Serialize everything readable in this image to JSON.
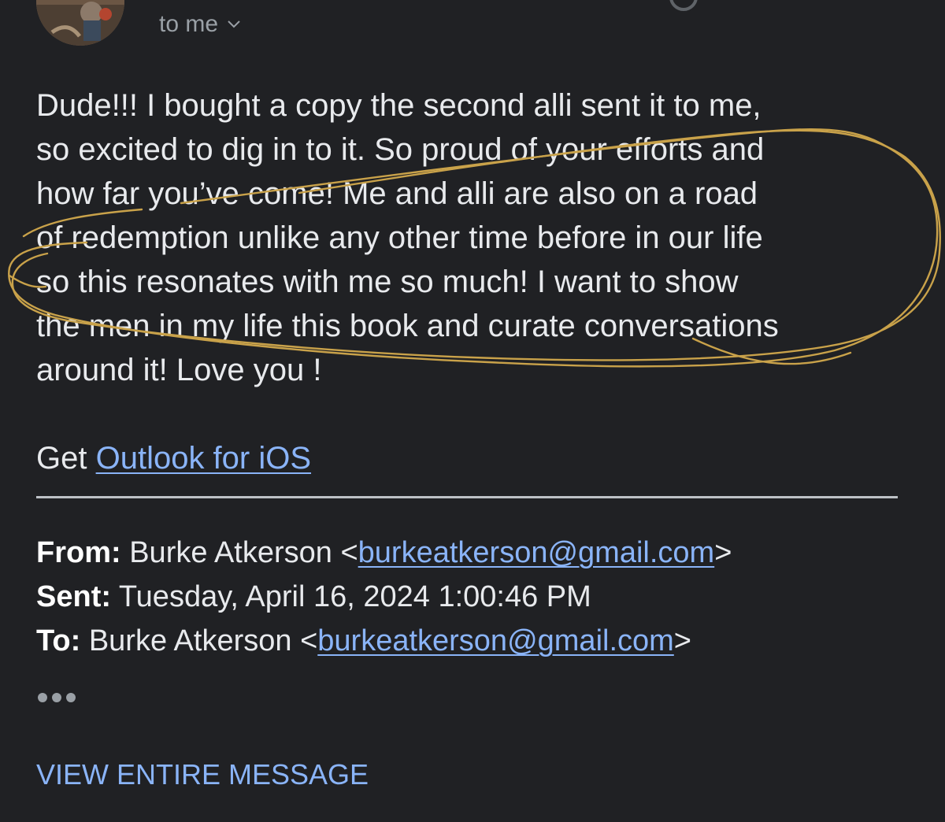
{
  "header": {
    "recipient_label": "to me"
  },
  "message": {
    "body_lines": [
      "Dude!!! I bought a copy the second alli sent it to me,",
      "so excited to dig in to it. So proud of your efforts and",
      "how far you’ve come! Me and alli are also on a road",
      "of redemption unlike any other time before in our life",
      "so this resonates with me so much! I want to show",
      "the men in my life this book and curate conversations",
      "around it! Love you !"
    ],
    "signature_prefix": "Get ",
    "signature_link": "Outlook for iOS"
  },
  "quoted_header": {
    "from_label": "From:",
    "from_name": " Burke Atkerson <",
    "from_email": "burkeatkerson@gmail.com",
    "from_suffix": ">",
    "sent_label": "Sent:",
    "sent_value": " Tuesday, April 16, 2024 1:00:46 PM",
    "to_label": "To:",
    "to_name": " Burke Atkerson <",
    "to_email": "burkeatkerson@gmail.com",
    "to_suffix": ">"
  },
  "actions": {
    "view_entire_message": "VIEW ENTIRE MESSAGE",
    "more_icon": "more-dots-icon"
  },
  "colors": {
    "background": "#202124",
    "text": "#e8eaed",
    "link": "#8ab4f8",
    "annotation": "#c9a24a"
  }
}
